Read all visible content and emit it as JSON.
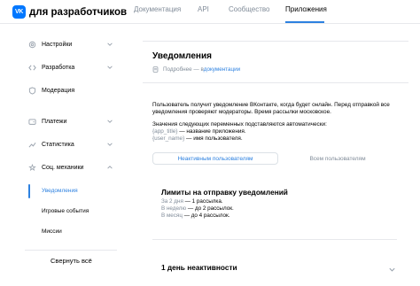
{
  "header": {
    "logo_badge": "VK",
    "logo_text": "для разработчиков",
    "nav": [
      {
        "label": "Документация"
      },
      {
        "label": "API"
      },
      {
        "label": "Сообщество"
      },
      {
        "label": "Приложения"
      }
    ],
    "active_nav": "Приложения",
    "accent": "#2d81e0"
  },
  "sidebar": {
    "items": [
      {
        "label": "Настройки",
        "icon": "gear-icon"
      },
      {
        "label": "Разработка",
        "icon": "code-icon"
      },
      {
        "label": "Модерация",
        "icon": "shield-icon"
      },
      {
        "label": "Платежи",
        "icon": "wallet-icon"
      },
      {
        "label": "Статистика",
        "icon": "chart-icon"
      },
      {
        "label": "Соц. механики",
        "icon": "social-icon"
      }
    ],
    "subitems": [
      {
        "label": "Уведомления"
      },
      {
        "label": "Игровые события"
      },
      {
        "label": "Миссии"
      }
    ],
    "collapse_label": "Свернуть всё"
  },
  "main": {
    "title": "Уведомления",
    "more_prefix": "Подробнее — в ",
    "more_link": "документации",
    "description": [
      "Пользователь получит уведомление ВКонтакте, когда будет онлайн. Перед отправкой все",
      "уведомления проверяют модераторы. Время рассылки московское."
    ],
    "vars_intro": "Значения следующих переменных подставляются автоматически:",
    "vars": [
      {
        "name": "{app_title}",
        "desc": " — название приложения."
      },
      {
        "name": "{user_name}",
        "desc": " — имя пользователя."
      }
    ],
    "tabs": {
      "active": "Неактивным пользователям",
      "inactive": "Всем пользователям"
    },
    "limits": {
      "title": "Лимиты на отправку уведомлений",
      "rows": [
        {
          "label": "За 2 дня",
          "value": " — 1 рассылка."
        },
        {
          "label": "В неделю",
          "value": " — до 2 рассылок."
        },
        {
          "label": "В месяц",
          "value": " — до 4 рассылок."
        }
      ]
    },
    "inactive_section": "1 день неактивности"
  }
}
